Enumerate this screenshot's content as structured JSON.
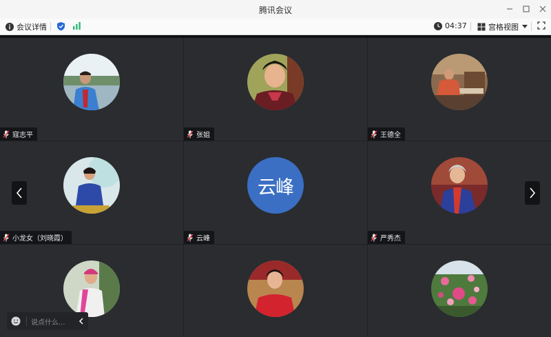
{
  "window": {
    "title": "腾讯会议"
  },
  "toolbar": {
    "meeting_details": "会议详情",
    "timer": "04:37",
    "view_mode": "宫格视图"
  },
  "participants": [
    {
      "name": "寇志平"
    },
    {
      "name": "张姐"
    },
    {
      "name": "王德全"
    },
    {
      "name": "小龙女（刘晓霞）"
    },
    {
      "name": "云峰",
      "avatar_text": "云峰"
    },
    {
      "name": "严秀杰"
    },
    {
      "name": ""
    },
    {
      "name": ""
    },
    {
      "name": ""
    }
  ],
  "chat": {
    "placeholder": "说点什么..."
  },
  "colors": {
    "tile_bg": "#2a2c30",
    "accent_blue": "#3a6fc4",
    "signal_green": "#2bb673"
  }
}
